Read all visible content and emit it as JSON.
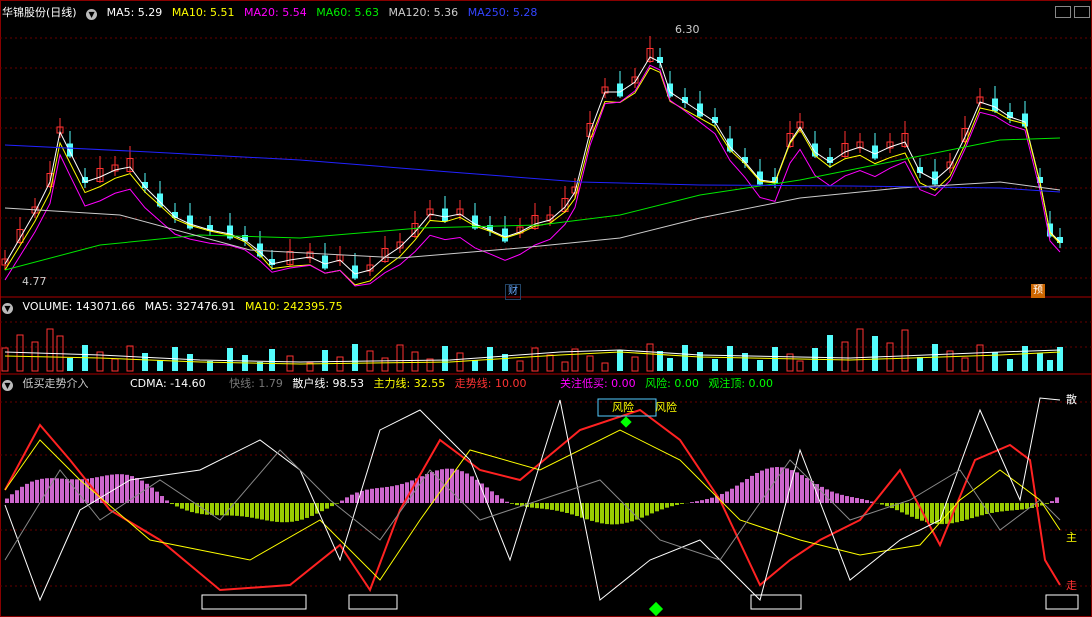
{
  "main": {
    "title": "华锦股份(日线)",
    "ma5": "MA5: 5.29",
    "ma10": "MA10: 5.51",
    "ma20": "MA20: 5.54",
    "ma60": "MA60: 5.63",
    "ma120": "MA120: 5.36",
    "ma250": "MA250: 5.28",
    "high_label": "6.30",
    "low_label": "4.77",
    "marker_cai": "财",
    "marker_yu": "预"
  },
  "volume": {
    "volume": "VOLUME: 143071.66",
    "ma5": "MA5: 327476.91",
    "ma10": "MA10: 242395.75"
  },
  "indicator": {
    "name": "低买走势介入",
    "cdma": "CDMA: -14.60",
    "kuai": "快线: 1.79",
    "sanhu": "散户线: 98.53",
    "zhuli": "主力线: 32.55",
    "zoushi": "走势线: 10.00",
    "guanzhu": "关注低买: 0.00",
    "fengxian": "风险: 0.00",
    "guanzhuding": "观注顶: 0.00",
    "risk_label1": "风险",
    "risk_label2": "风险",
    "right_san": "散",
    "right_zhu": "主",
    "right_zou": "走"
  },
  "colors": {
    "up": "#ff3232",
    "down": "#54fcfc",
    "ma5": "#ffffff",
    "ma10": "#ffff00",
    "ma20": "#ff00ff",
    "ma60": "#00e600",
    "ma120": "#cccccc",
    "ma250": "#2222ff"
  }
}
